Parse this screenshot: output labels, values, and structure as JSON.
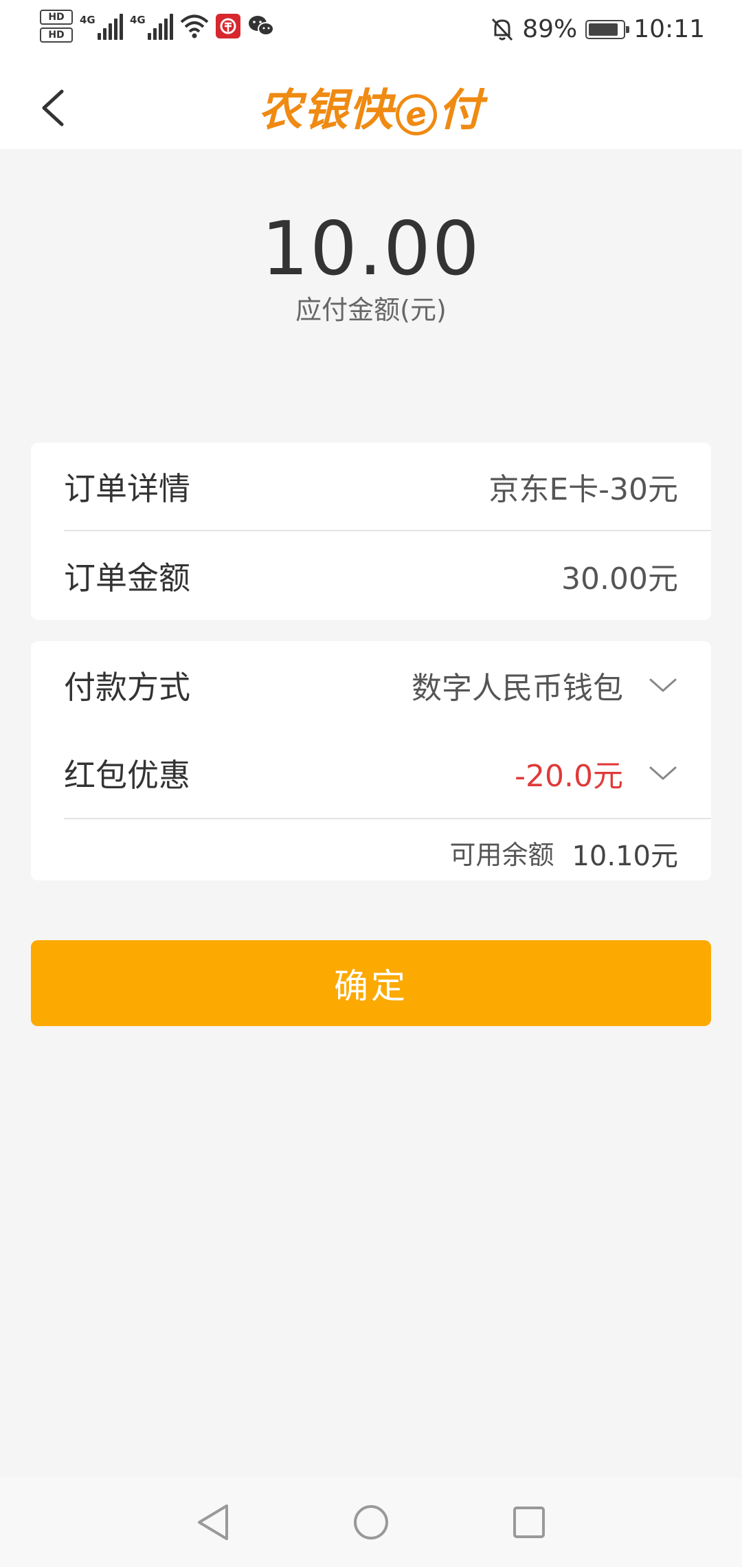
{
  "status_bar": {
    "hd1": "HD",
    "hd2": "HD",
    "net1": "4G",
    "net2": "4G",
    "battery_pct": "89%",
    "time": "10:11",
    "icons": [
      "hd-icon",
      "signal-icon",
      "wifi-icon",
      "ecny-icon",
      "wechat-icon",
      "mute-icon",
      "battery-icon"
    ]
  },
  "header": {
    "logo_part1": "农银快",
    "logo_e": "e",
    "logo_part2": "付"
  },
  "amount": {
    "value": "10.00",
    "label": "应付金额(元)"
  },
  "order": {
    "detail_label": "订单详情",
    "detail_value": "京东E卡-30元",
    "amount_label": "订单金额",
    "amount_value": "30.00元"
  },
  "payment": {
    "method_label": "付款方式",
    "method_value": "数字人民币钱包",
    "discount_label": "红包优惠",
    "discount_value": "-20.0元",
    "balance_label": "可用余额",
    "balance_value": "10.10元"
  },
  "confirm_label": "确定",
  "colors": {
    "brand": "#ef8a12",
    "button": "#fca902",
    "discount": "#e03a3a",
    "background": "#f5f5f5"
  }
}
